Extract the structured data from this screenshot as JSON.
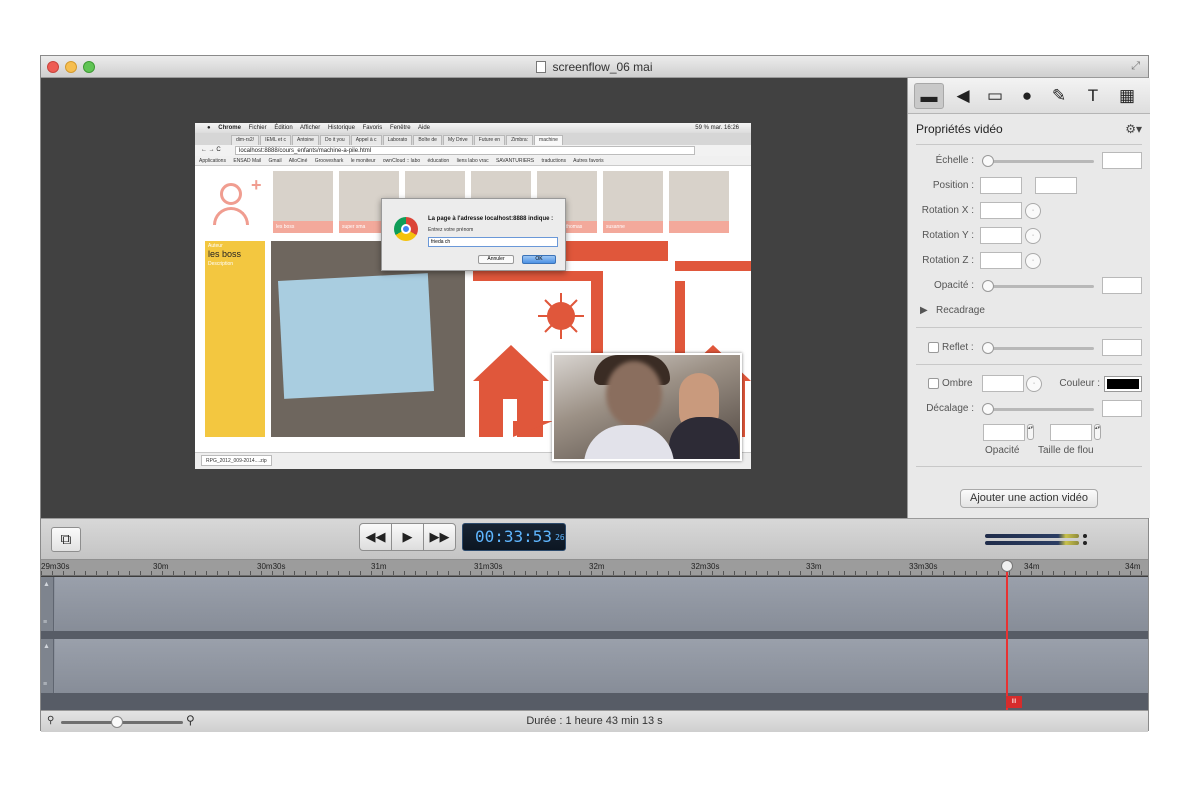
{
  "window": {
    "title": "screenflow_06 mai"
  },
  "recording": {
    "menubar": [
      "Chrome",
      "Fichier",
      "Édition",
      "Afficher",
      "Historique",
      "Favoris",
      "Fenêtre",
      "Aide"
    ],
    "menubar_right": "59 % mar. 16:26",
    "tabs": [
      "dim-rs2/",
      "IEML et c",
      "Antoine",
      "Do it you",
      "Appel à c",
      "Laborato",
      "Boîte de",
      "My Drive",
      "Future en",
      "Zimbra:",
      "machine"
    ],
    "url": "localhost:8888/cours_enfants/machine-a-pile.html",
    "bookmarks": [
      "Applications",
      "ENSAD Mail",
      "Gmail",
      "AlloCiné",
      "Grooveshark",
      "le moniteur",
      "ownCloud :: labo",
      "éducation",
      "liens labo vrac",
      "SAVANTURIERS",
      "traductions",
      "Autres favoris"
    ],
    "thumb_captions": [
      "les boss",
      "super sma",
      "",
      "",
      "younous et thomas",
      "susanne"
    ],
    "sidebar": {
      "author_label": "Auteur",
      "author_name": "les boss",
      "description_label": "Description"
    },
    "dialog": {
      "title": "La page à l'adresse localhost:8888 indique :",
      "prompt": "Entrez votre prénom",
      "value": "frieda  ch",
      "cancel": "Annuler",
      "ok": "OK"
    },
    "download": "RPG_2012_009-2014....zip"
  },
  "inspector": {
    "tools": [
      {
        "icon": "video-camera-icon",
        "glyph": "▬"
      },
      {
        "icon": "speaker-icon",
        "glyph": "◀"
      },
      {
        "icon": "screen-icon",
        "glyph": "▭"
      },
      {
        "icon": "cursor-icon",
        "glyph": "●"
      },
      {
        "icon": "annotation-icon",
        "glyph": "✎"
      },
      {
        "icon": "text-icon",
        "glyph": "T"
      },
      {
        "icon": "media-icon",
        "glyph": "▦"
      }
    ],
    "header": "Propriétés vidéo",
    "labels": {
      "scale": "Échelle :",
      "position": "Position :",
      "rotation_x": "Rotation X :",
      "rotation_y": "Rotation Y :",
      "rotation_z": "Rotation Z :",
      "opacity": "Opacité :",
      "crop": "Recadrage",
      "reflection": "Reflet :",
      "shadow": "Ombre",
      "color": "Couleur :",
      "offset": "Décalage :",
      "shadow_opacity": "Opacité",
      "blur_size": "Taille de flou"
    },
    "action_button": "Ajouter une action vidéo",
    "shadow_color": "#000000"
  },
  "transport": {
    "timecode": "00:33:53",
    "frames": "26"
  },
  "timeline": {
    "ruler": [
      "29m30s",
      "30m",
      "30m30s",
      "31m",
      "31m30s",
      "32m",
      "32m30s",
      "33m",
      "33m30s",
      "34m",
      "34m"
    ],
    "playhead_label": "III"
  },
  "status": {
    "duration": "Durée : 1 heure 43 min 13 s"
  }
}
